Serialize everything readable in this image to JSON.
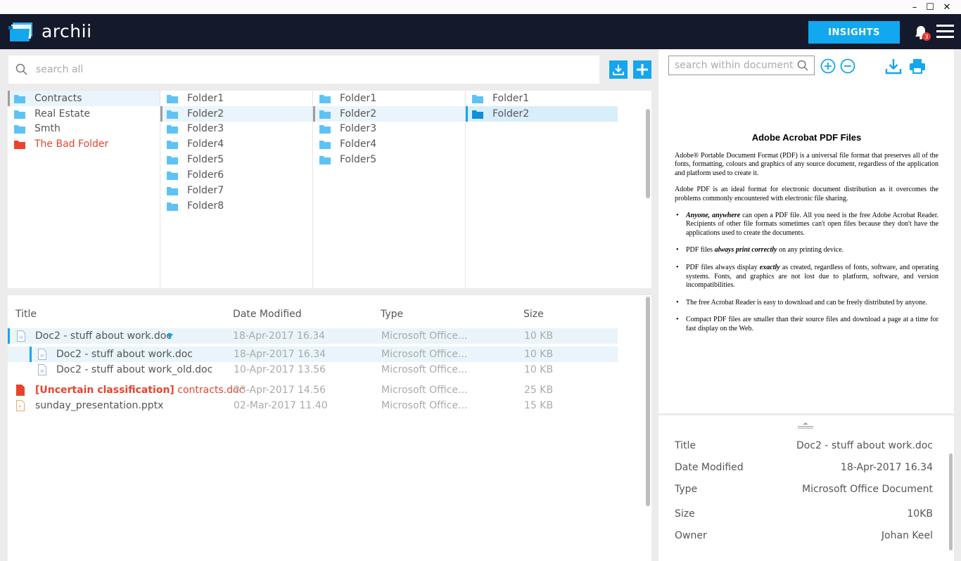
{
  "window": {
    "minimize": "–",
    "maximize": "☐",
    "close": "✕"
  },
  "app": {
    "name": "archii",
    "insights_label": "INSIGHTS",
    "notification_count": "3"
  },
  "search": {
    "placeholder": "search all"
  },
  "colors": {
    "accent": "#14a6ee",
    "header": "#14192b",
    "danger": "#e8432d",
    "folder": "#5ec3f4"
  },
  "columns": [
    {
      "items": [
        {
          "label": "Contracts",
          "selected": true
        },
        {
          "label": "Real Estate"
        },
        {
          "label": "Smth"
        },
        {
          "label": "The Bad Folder",
          "danger": true
        }
      ]
    },
    {
      "items": [
        {
          "label": "Folder1"
        },
        {
          "label": "Folder2",
          "selected": true
        },
        {
          "label": "Folder3"
        },
        {
          "label": "Folder4"
        },
        {
          "label": "Folder5"
        },
        {
          "label": "Folder6"
        },
        {
          "label": "Folder7"
        },
        {
          "label": "Folder8"
        }
      ]
    },
    {
      "items": [
        {
          "label": "Folder1"
        },
        {
          "label": "Folder2",
          "selected": true
        },
        {
          "label": "Folder3"
        },
        {
          "label": "Folder4"
        },
        {
          "label": "Folder5"
        }
      ]
    },
    {
      "items": [
        {
          "label": "Folder1"
        },
        {
          "label": "Folder2",
          "selected": true,
          "active": true
        }
      ]
    }
  ],
  "files": {
    "headers": {
      "title": "Title",
      "date": "Date Modified",
      "type": "Type",
      "size": "Size"
    },
    "rows": [
      {
        "title": "Doc2 - stuff about work.doc",
        "date": "18-Apr-2017 16.34",
        "type": "Microsoft Office...",
        "size": "10 KB"
      },
      {
        "title": "Doc2 - stuff about work.doc",
        "date": "18-Apr-2017 16.34",
        "type": "Microsoft Office...",
        "size": "10 KB"
      },
      {
        "title": "Doc2 - stuff about work_old.doc",
        "date": "10-Apr-2017 13.56",
        "type": "Microsoft Office...",
        "size": "10 KB"
      },
      {
        "title_prefix": "[Uncertain classification]",
        "title": "contracts.doc",
        "date": "23-Apr-2017 14.56",
        "type": "Microsoft Office...",
        "size": "25 KB"
      },
      {
        "title": "sunday_presentation.pptx",
        "date": "02-Mar-2017 11.40",
        "type": "Microsoft Office...",
        "size": "15 KB"
      }
    ]
  },
  "preview": {
    "search_placeholder": "search within document",
    "doc": {
      "title": "Adobe Acrobat PDF Files",
      "p1": "Adobe® Portable Document Format (PDF) is a universal file format that preserves all of the fonts, formatting, colours and graphics of any source document, regardless of the application and platform used to create it.",
      "p2": "Adobe PDF is an ideal format for electronic document distribution as it overcomes the problems commonly encountered with electronic file sharing.",
      "b1_em": "Anyone, anywhere",
      "b1": " can open a PDF file. All you need is the free Adobe Acrobat Reader. Recipients of other file formats sometimes can't open files because they don't have the applications used to create the documents.",
      "b2_pre": "PDF files ",
      "b2_em": "always print correctly",
      "b2": " on any printing device.",
      "b3_pre": "PDF files always display ",
      "b3_em": "exactly",
      "b3": " as created, regardless of fonts, software, and operating systems. Fonts, and graphics are not lost due to platform, software, and version incompatibilities.",
      "b4": "The free Acrobat Reader is easy to download and can be freely distributed by anyone.",
      "b5": "Compact PDF files are smaller than their source files and download a page at a time for fast display on the Web."
    }
  },
  "properties": [
    {
      "label": "Title",
      "value": "Doc2 - stuff about work.doc"
    },
    {
      "label": "Date Modified",
      "value": "18-Apr-2017 16.34"
    },
    {
      "label": "Type",
      "value": "Microsoft Office Document"
    },
    {
      "label": "Size",
      "value": "10KB"
    },
    {
      "label": "Owner",
      "value": "Johan Keel"
    }
  ]
}
